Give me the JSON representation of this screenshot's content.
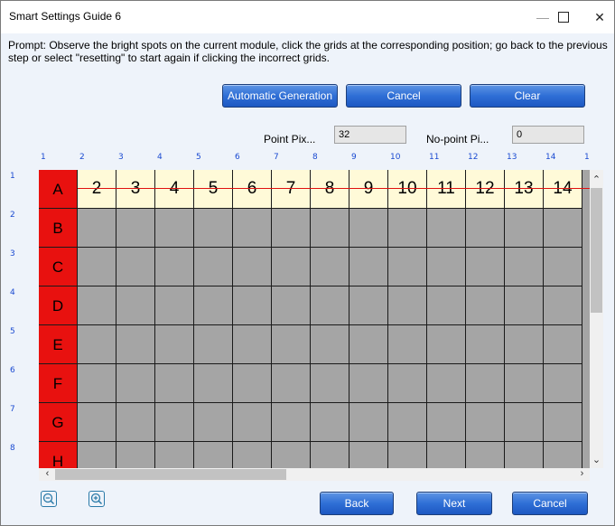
{
  "window": {
    "title": "Smart Settings Guide 6"
  },
  "controls": {
    "minimize": "—",
    "maximize": "□",
    "close": "✕"
  },
  "prompt": "Prompt: Observe the bright spots on the current module, click the grids at the corresponding position; go back to the previous step or select \"resetting\" to start again if clicking the incorrect grids.",
  "actions": {
    "auto": "Automatic Generation",
    "cancel": "Cancel",
    "clear": "Clear"
  },
  "fields": {
    "point_label": "Point Pix...",
    "point_value": "32",
    "nopoint_label": "No-point Pi...",
    "nopoint_value": "0"
  },
  "col_numbers": [
    "1",
    "2",
    "3",
    "4",
    "5",
    "6",
    "7",
    "8",
    "9",
    "10",
    "11",
    "12",
    "13",
    "14",
    "1"
  ],
  "row_numbers": [
    "1",
    "2",
    "3",
    "4",
    "5",
    "6",
    "7",
    "8"
  ],
  "header_cells": [
    "A",
    "2",
    "3",
    "4",
    "5",
    "6",
    "7",
    "8",
    "9",
    "10",
    "11",
    "12",
    "13",
    "14"
  ],
  "row_labels": [
    "A",
    "B",
    "C",
    "D",
    "E",
    "F",
    "G",
    "H"
  ],
  "footer": {
    "back": "Back",
    "next": "Next",
    "cancel": "Cancel"
  },
  "icons": {
    "zoom_out": "zoom-out-icon",
    "zoom_in": "zoom-in-icon"
  },
  "colors": {
    "button": "#2f6fd6",
    "row_header": "#e8110f",
    "header_row": "#fffad8",
    "grid_cell": "#a5a5a5",
    "strike_line": "#e01010"
  }
}
